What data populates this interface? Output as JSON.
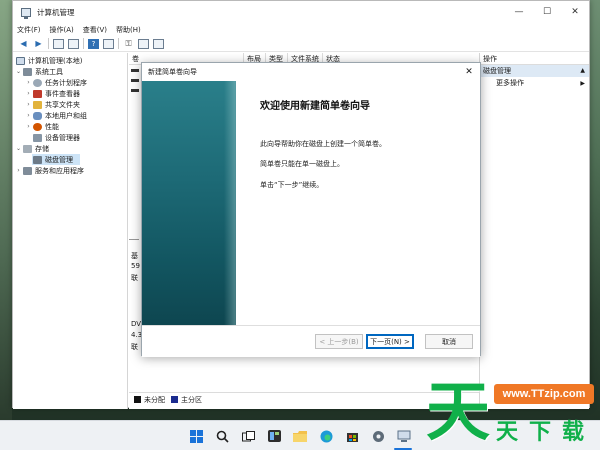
{
  "window": {
    "title": "计算机管理",
    "minimize": "—",
    "maximize": "☐",
    "close": "✕"
  },
  "menu": [
    "文件(F)",
    "操作(A)",
    "查看(V)",
    "帮助(H)"
  ],
  "tree": {
    "root": "计算机管理(本地)",
    "system_tools": "系统工具",
    "task_scheduler": "任务计划程序",
    "event_viewer": "事件查看器",
    "shared_folders": "共享文件夹",
    "local_users": "本地用户和组",
    "performance": "性能",
    "device_manager": "设备管理器",
    "storage": "存储",
    "disk_management": "磁盘管理",
    "services": "服务和应用程序"
  },
  "columns": [
    "卷",
    "布局",
    "类型",
    "文件系统",
    "状态"
  ],
  "disks": {
    "basic_line1": "基",
    "basic_line2": "59",
    "basic_line3": "联",
    "dvd_line1": "DV",
    "dvd_line2": "4.3",
    "dvd_line3": "联"
  },
  "legend": {
    "unallocated": "未分配",
    "primary": "主分区"
  },
  "actions": {
    "header": "操作",
    "selected": "磁盘管理",
    "more": "更多操作"
  },
  "wizard": {
    "title": "新建简单卷向导",
    "heading": "欢迎使用新建简单卷向导",
    "line1": "此向导帮助你在磁盘上创建一个简单卷。",
    "line2": "简单卷只能在单一磁盘上。",
    "line3": "单击“下一步”继续。",
    "back": "< 上一步(B)",
    "next": "下一页(N) >",
    "cancel": "取消"
  },
  "watermark": {
    "url": "www.TTzip.com",
    "big": "天",
    "small1": "天",
    "small2": "下",
    "small3": "载"
  },
  "colors": {
    "accent": "#0067c0",
    "banner": "#1d6a76",
    "watermark_green": "#10b04a",
    "watermark_orange": "#f07826"
  }
}
